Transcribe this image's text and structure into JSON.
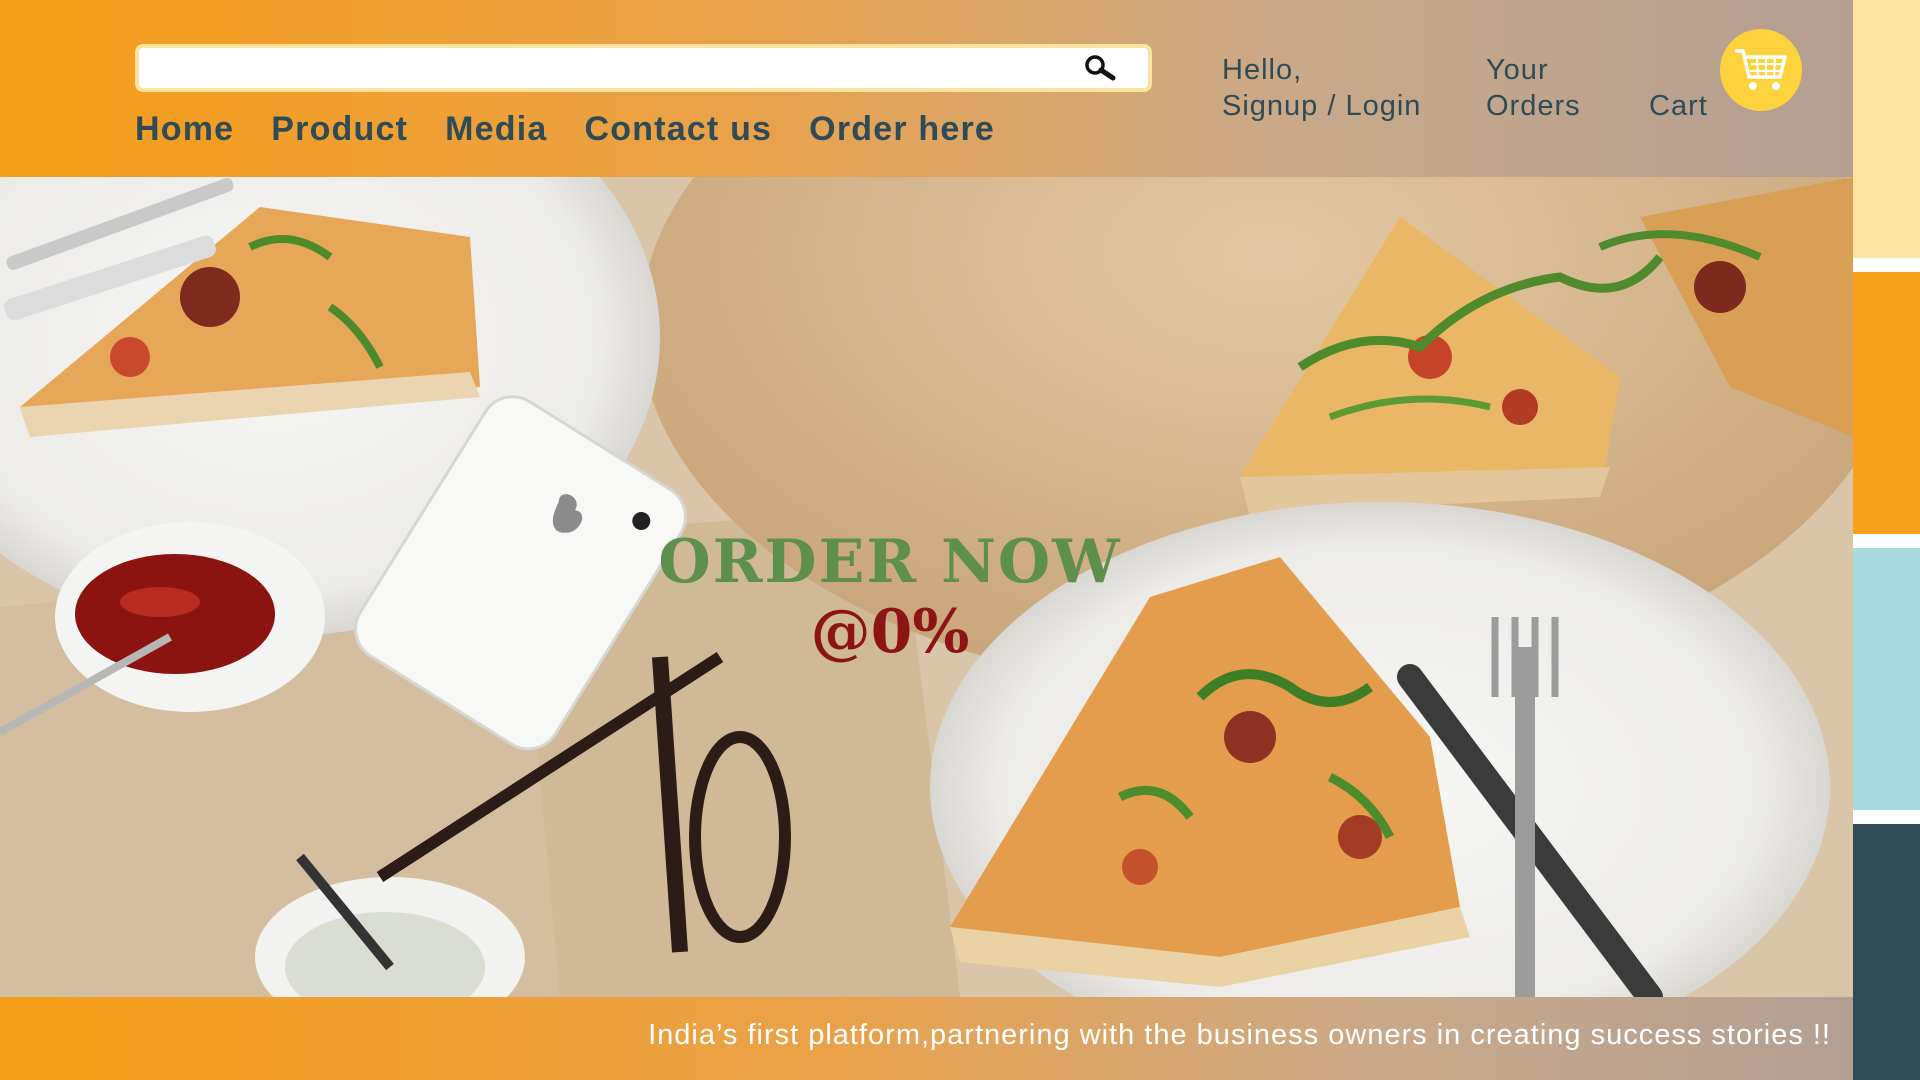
{
  "search": {
    "value": "",
    "placeholder": "",
    "icon": "search-icon"
  },
  "nav": {
    "items": [
      {
        "label": "Home"
      },
      {
        "label": "Product"
      },
      {
        "label": "Media"
      },
      {
        "label": "Contact us"
      },
      {
        "label": "Order here"
      }
    ]
  },
  "account": {
    "line1": "Hello,",
    "line2": "Signup / Login"
  },
  "orders": {
    "line1": "Your",
    "line2": "Orders"
  },
  "cart": {
    "label": "Cart",
    "icon": "shopping-cart-icon"
  },
  "promo": {
    "title": "ORDER NOW",
    "discount": "@0%"
  },
  "footer": {
    "tagline": "India’s first platform,partnering with the business owners in creating success stories !!"
  },
  "palette": {
    "colors": [
      "#fbe3a0",
      "#f9a01b",
      "#a8dbe0",
      "#2f4b55"
    ]
  },
  "theme": {
    "accent": "#f59d17",
    "nav_text": "#2f4b55",
    "promo_green": "#5e8f4c",
    "promo_red": "#8d1414",
    "cart_yellow": "#fdd33d"
  }
}
